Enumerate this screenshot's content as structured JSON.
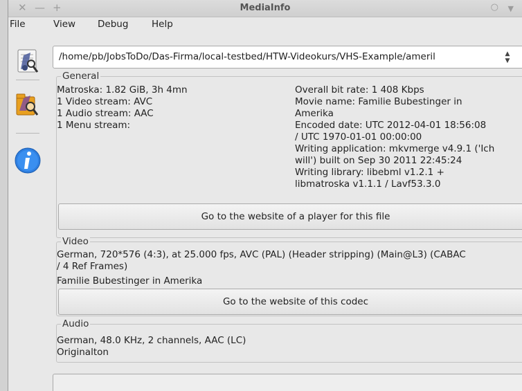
{
  "window": {
    "title": "MediaInfo"
  },
  "menu": [
    "File",
    "View",
    "Debug",
    "Help"
  ],
  "sidebar": {
    "icons": [
      "sheet-view-icon",
      "tree-view-icon",
      "info-icon"
    ]
  },
  "path": {
    "value": "/home/pb/JobsToDo/Das-Firma/local-testbed/HTW-Videokurs/VHS-Example/ameril"
  },
  "general": {
    "title": "General",
    "left": [
      "Matroska: 1.82 GiB, 3h 4mn",
      "1 Video stream: AVC",
      "1 Audio stream: AAC",
      "1 Menu stream:"
    ],
    "right": [
      "Overall bit rate: 1 408 Kbps",
      "Movie name: Familie Bubestinger in",
      "Amerika",
      "Encoded date: UTC 2012-04-01 18:56:08",
      "/ UTC 1970-01-01 00:00:00",
      "Writing application: mkvmerge v4.9.1 ('Ich",
      "will') built on Sep 30 2011 22:45:24",
      "Writing library: libebml v1.2.1 +",
      "libmatroska v1.1.1 / Lavf53.3.0"
    ],
    "button": "Go to the website of a player for this file"
  },
  "video": {
    "title": "Video",
    "lines": [
      "German, 720*576 (4:3), at 25.000 fps, AVC (PAL) (Header stripping) (Main@L3) (CABAC",
      "/ 4 Ref Frames)",
      "Familie Bubestinger in Amerika"
    ],
    "button": "Go to the website of this codec"
  },
  "audio": {
    "title": "Audio",
    "lines": [
      "German, 48.0 KHz, 2 channels, AAC (LC)",
      "Originalton"
    ]
  }
}
